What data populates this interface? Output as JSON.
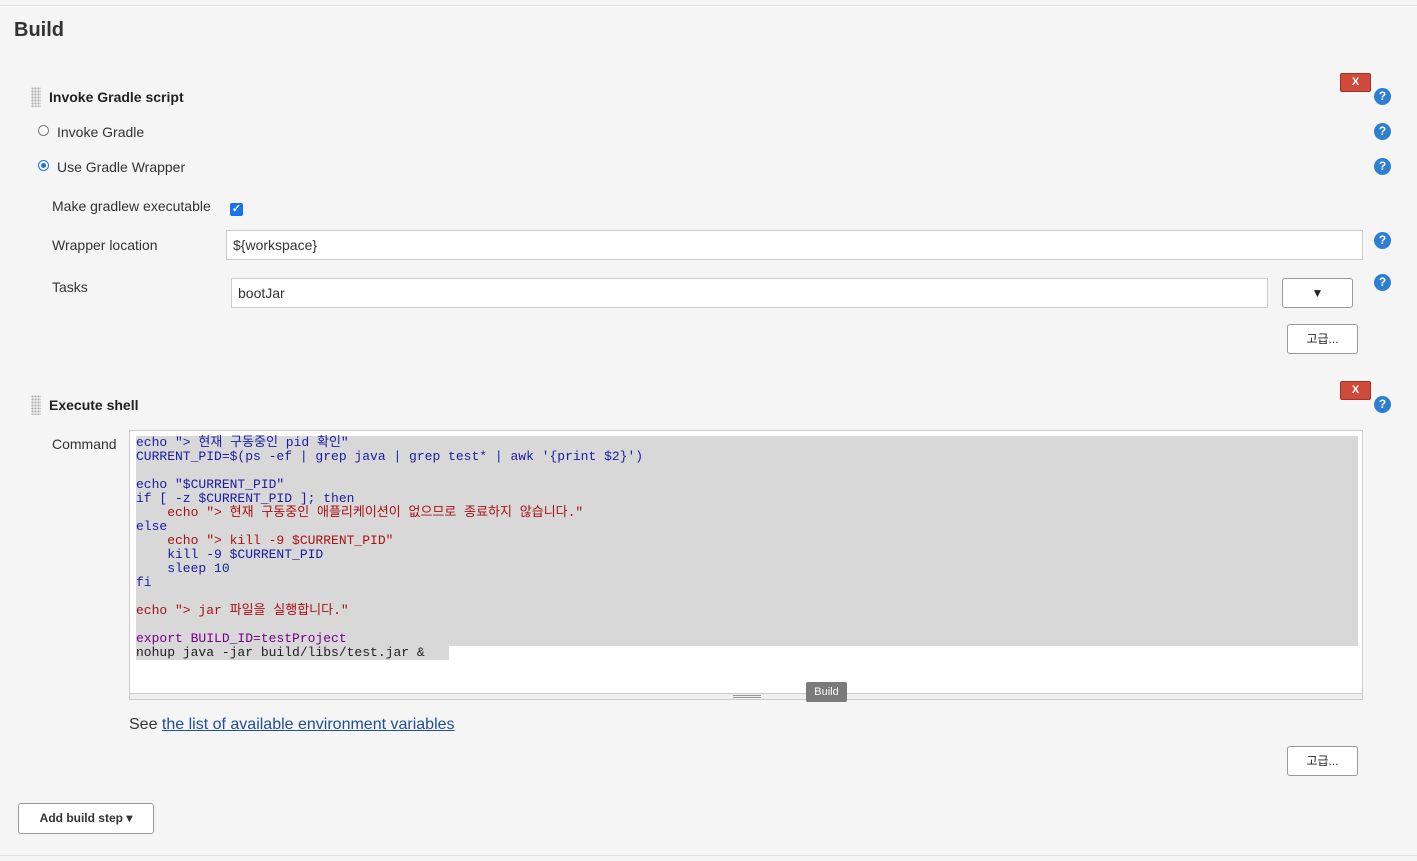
{
  "section": {
    "title": "Build"
  },
  "gradle_step": {
    "title": "Invoke Gradle script",
    "delete_label": "X",
    "help_label": "?",
    "radio_invoke_label": "Invoke Gradle",
    "radio_wrapper_label": "Use Gradle Wrapper",
    "make_executable_label": "Make gradlew executable",
    "make_executable_checked": true,
    "wrapper_location_label": "Wrapper location",
    "wrapper_location_value": "${workspace}",
    "tasks_label": "Tasks",
    "tasks_value": "bootJar",
    "tasks_dropdown": "▼",
    "advanced_label": "고급..."
  },
  "shell_step": {
    "title": "Execute shell",
    "delete_label": "X",
    "help_label": "?",
    "command_label": "Command",
    "tooltip": "Build",
    "see_prefix": "See ",
    "see_link": "the list of available environment variables",
    "advanced_label": "고급...",
    "command_lines": [
      "echo \"> 현재 구동중인 pid 확인\"",
      "CURRENT_PID=$(ps -ef | grep java | grep test* | awk '{print $2}')",
      "",
      "echo \"$CURRENT_PID\"",
      "if [ -z $CURRENT_PID ]; then",
      "    echo \"> 현재 구동중인 애플리케이션이 없으므로 종료하지 않습니다.\"",
      "else",
      "    echo \"> kill -9 $CURRENT_PID\"",
      "    kill -9 $CURRENT_PID",
      "    sleep 10",
      "fi",
      "",
      "echo \"> jar 파일을 실행합니다.\"",
      "",
      "export BUILD_ID=testProject",
      "nohup java -jar build/libs/test.jar &"
    ]
  },
  "add_build_step": {
    "label": "Add build step ▾"
  },
  "colors": {
    "delete_red": "#cf4a3a",
    "help_blue": "#2f7fd0",
    "link_blue": "#1f4e9a",
    "checkbox_blue": "#1a73e8"
  }
}
